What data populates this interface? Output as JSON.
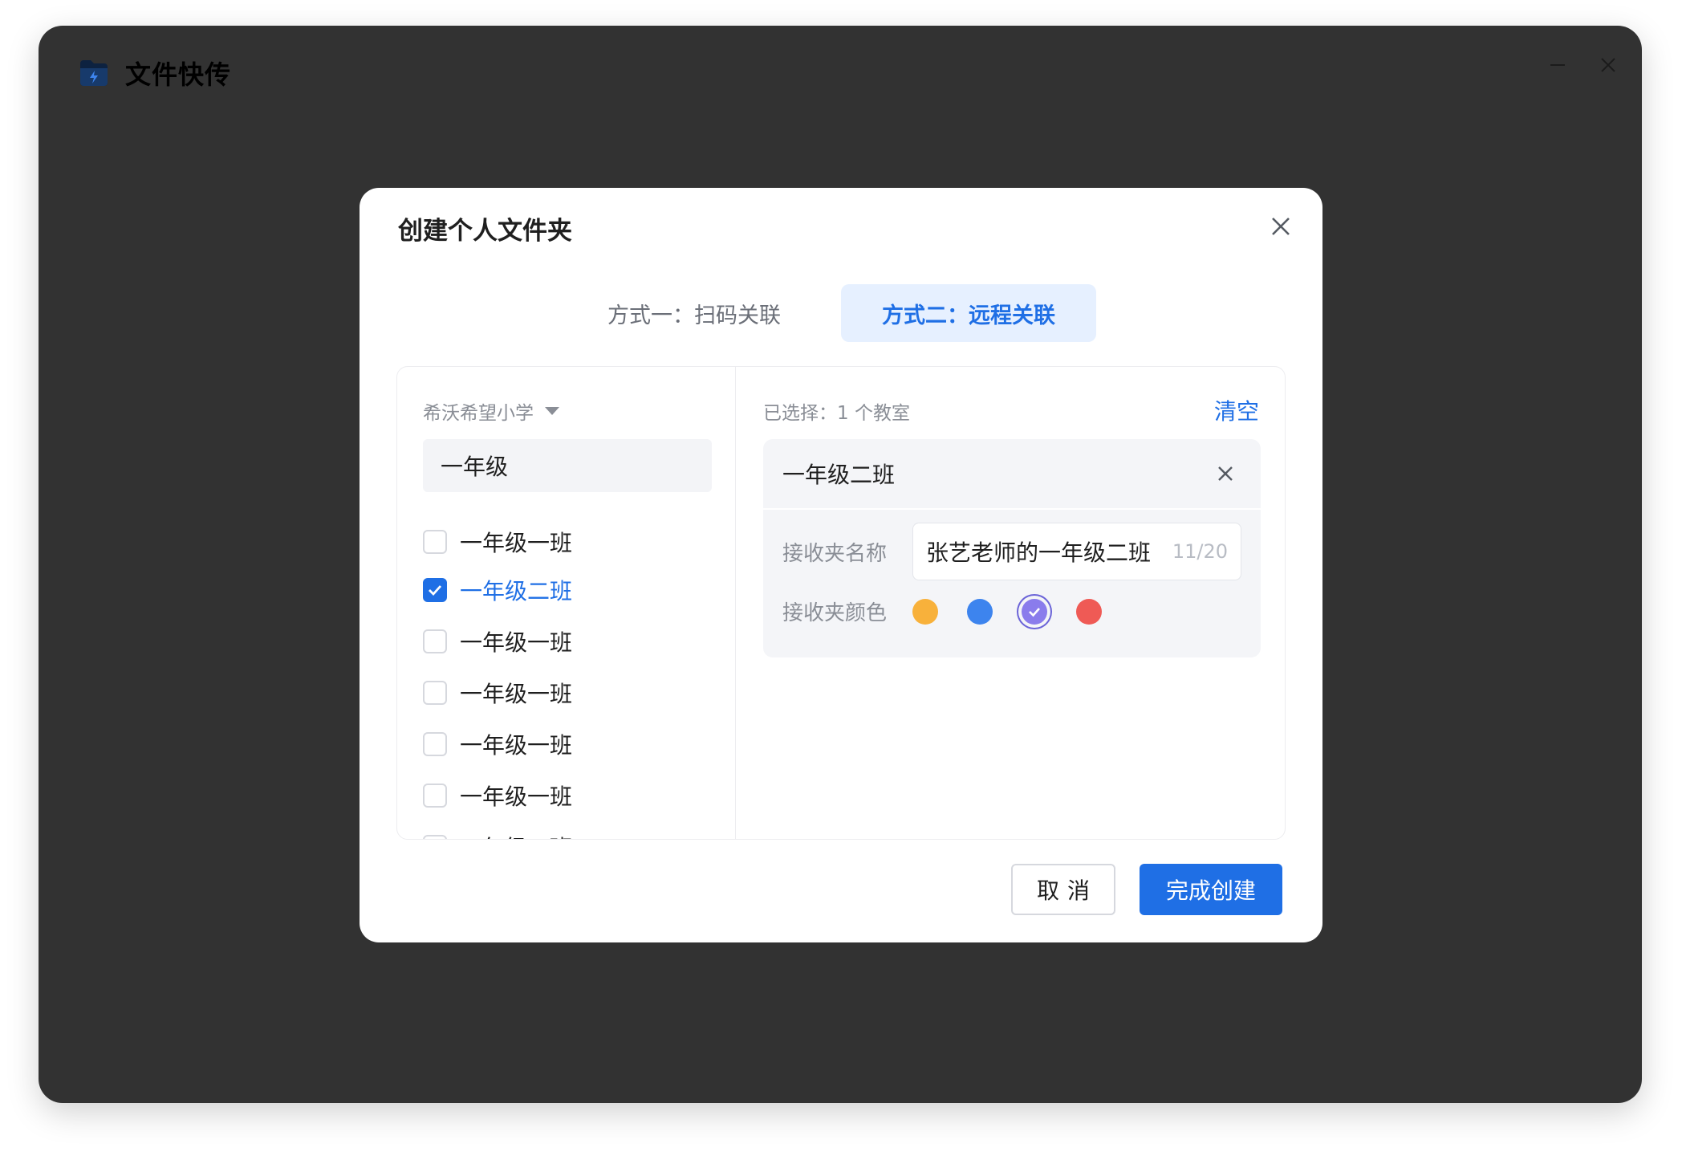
{
  "app": {
    "title": "文件快传",
    "logo_icon": "folder-lightning-icon"
  },
  "dialog": {
    "title": "创建个人文件夹",
    "tabs": [
      {
        "label": "方式一：扫码关联",
        "active": false
      },
      {
        "label": "方式二：远程关联",
        "active": true
      }
    ],
    "school": "希沃希望小学",
    "search": {
      "value": "一年级",
      "placeholder": ""
    },
    "classes": [
      {
        "label": "一年级一班",
        "checked": false
      },
      {
        "label": "一年级二班",
        "checked": true
      },
      {
        "label": "一年级一班",
        "checked": false
      },
      {
        "label": "一年级一班",
        "checked": false
      },
      {
        "label": "一年级一班",
        "checked": false
      },
      {
        "label": "一年级一班",
        "checked": false
      },
      {
        "label": "一年级一班",
        "checked": false
      }
    ],
    "selected_summary": "已选择：1 个教室",
    "clear_label": "清空",
    "selected_item": {
      "name": "一年级二班",
      "folder_name_label": "接收夹名称",
      "folder_name_value": "张艺老师的一年级二班",
      "folder_name_count": "11/20",
      "folder_color_label": "接收夹颜色",
      "colors": [
        "#f8b13b",
        "#3d84ee",
        "#8a7cec",
        "#ef5a55"
      ],
      "selected_color": "#8a7cec"
    },
    "cancel_label": "取消",
    "confirm_label": "完成创建"
  },
  "colors": {
    "accent": "#1f6fe5",
    "backdrop": "#323232",
    "tab_active_bg": "#e6f0ff"
  }
}
